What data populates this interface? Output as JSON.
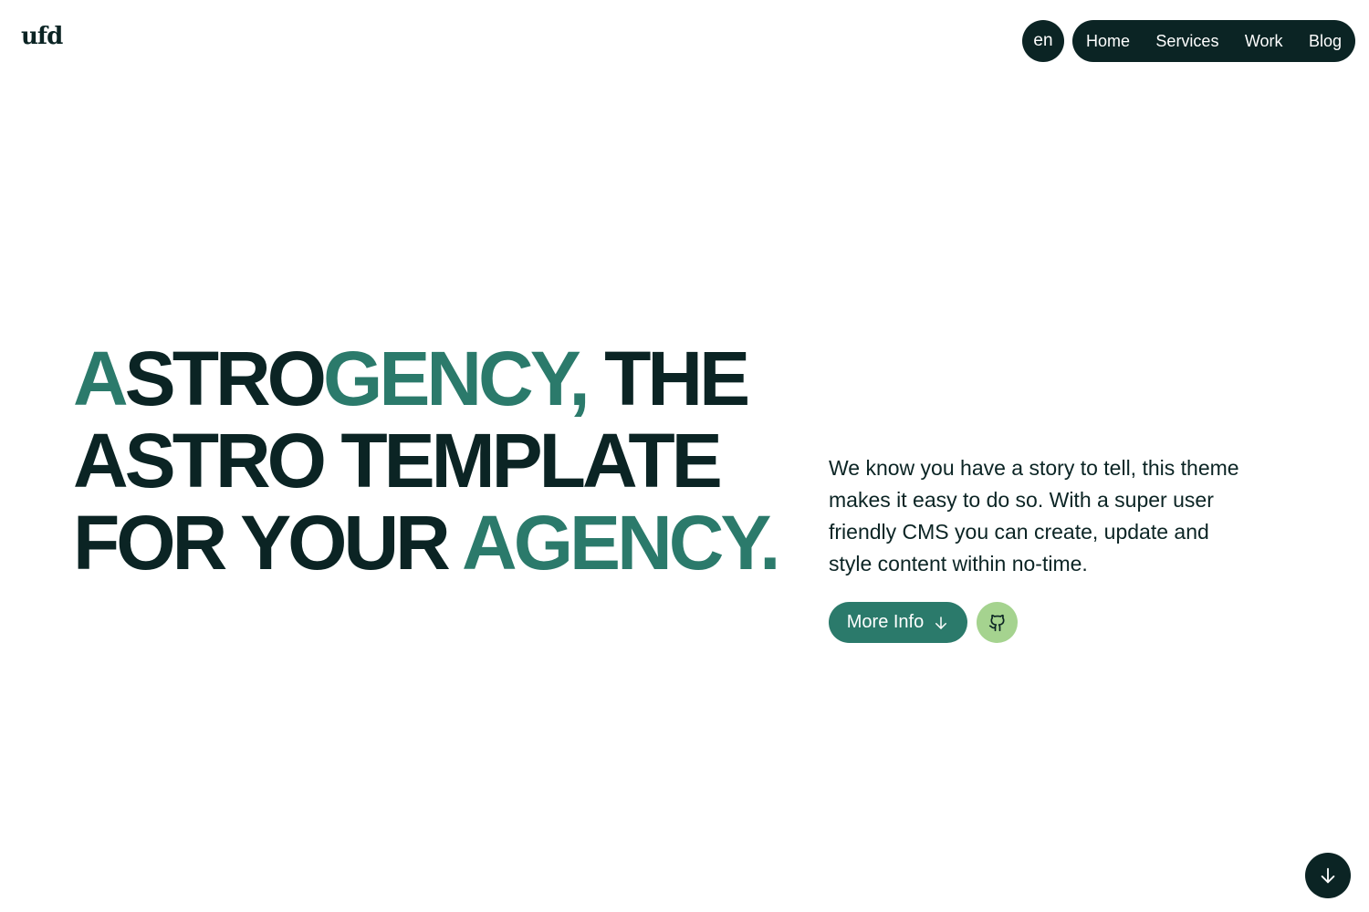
{
  "header": {
    "logo_text": "ufd",
    "language_label": "en",
    "nav": [
      {
        "label": "Home"
      },
      {
        "label": "Services"
      },
      {
        "label": "Work"
      },
      {
        "label": "Blog"
      }
    ]
  },
  "hero": {
    "headline": {
      "line1": {
        "accent_a": "A",
        "plain_a": "STRO",
        "accent_b": "GENCY,",
        "plain_b": " THE"
      },
      "line2": {
        "plain": "ASTRO TEMPLATE"
      },
      "line3": {
        "plain": "FOR YOUR ",
        "accent": "AGENCY."
      }
    },
    "description": "We know you have a story to tell, this theme makes it easy to do so. With a super user friendly CMS you can create, update and style content within no-time.",
    "more_info_label": "More Info"
  },
  "icons": {
    "more_info": "arrow-down-icon",
    "github": "github-icon",
    "scroll": "arrow-down-icon"
  },
  "colors": {
    "dark": "#0b2424",
    "accent": "#2b7a6b",
    "github_button": "#a5d38f",
    "background": "#ffffff"
  }
}
